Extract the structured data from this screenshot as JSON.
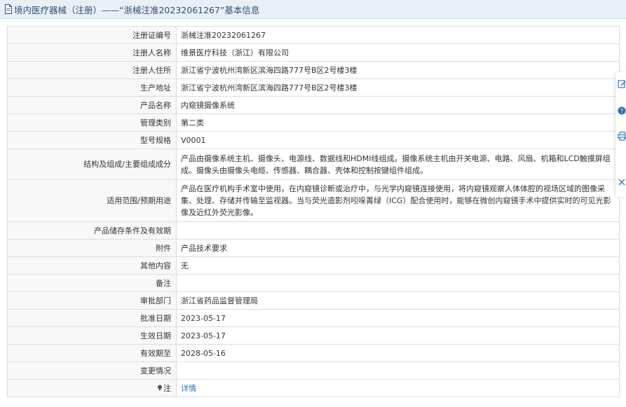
{
  "header": {
    "title": "境内医疗器械（注册）——“浙械注准20232061267”基本信息",
    "icon": "document-icon"
  },
  "rows": [
    {
      "label": "注册证编号",
      "value": "浙械注准20232061267"
    },
    {
      "label": "注册人名称",
      "value": "维景医疗科技（浙江）有限公司"
    },
    {
      "label": "注册人住所",
      "value": "浙江省宁波杭州湾新区滨海四路777号B区2号楼3楼"
    },
    {
      "label": "生产地址",
      "value": "浙江省宁波杭州湾新区滨海四路777号B区2号楼3楼"
    },
    {
      "label": "产品名称",
      "value": "内窥镜摄像系统"
    },
    {
      "label": "管理类别",
      "value": "第二类"
    },
    {
      "label": "型号规格",
      "value": "V0001"
    },
    {
      "label": "结构及组成/主要组成成分",
      "value": "产品由摄像系统主机、摄像头、电源线、数据线和HDMI线组成。摄像系统主机由开关电源、电路、风扇、机箱和LCD触摸屏组成。摄像头由摄像头电缆、传感器、耦合器、壳体和控制按键组件组成。"
    },
    {
      "label": "适用范围/预期用途",
      "value": "产品在医疗机构手术室中使用，在内窥镜诊断或治疗中，与光学内窥镜连接使用，将内窥镜观察人体体腔的视场区域的图像采集、处理、存储并传输至监视器。当与荧光造影剂吲哚菁绿（ICG）配合使用时，能够在微创内窥镜手术中提供实时的可见光影像及近红外荧光影像。"
    },
    {
      "label": "产品储存条件及有效期",
      "value": ""
    },
    {
      "label": "附件",
      "value": "产品技术要求"
    },
    {
      "label": "其他内容",
      "value": "无"
    },
    {
      "label": "备注",
      "value": ""
    },
    {
      "label": "审批部门",
      "value": "浙江省药品监督管理局"
    },
    {
      "label": "批准日期",
      "value": "2023-05-17"
    },
    {
      "label": "生效日期",
      "value": "2023-05-17"
    },
    {
      "label": "有效期至",
      "value": "2028-05-16"
    },
    {
      "label": "变更情况",
      "value": ""
    }
  ],
  "note": {
    "label": "注",
    "link": "详情",
    "icon": "pin-icon"
  },
  "side_tools": [
    "edit-icon",
    "help-icon",
    "print-icon",
    "close-icon"
  ]
}
